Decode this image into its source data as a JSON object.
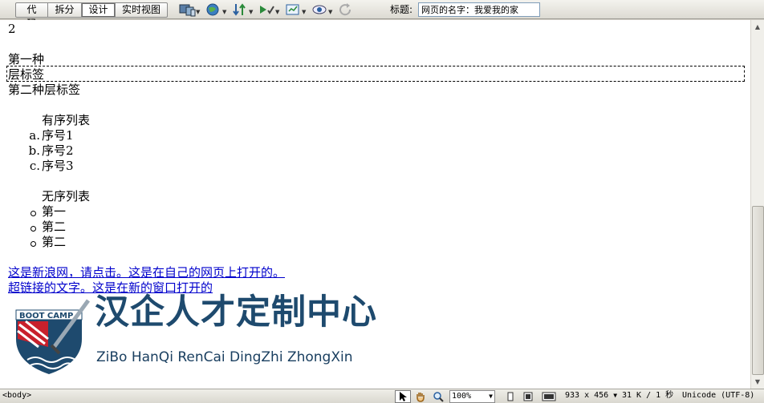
{
  "toolbar": {
    "views": [
      {
        "label": "代码",
        "active": false
      },
      {
        "label": "拆分",
        "active": false
      },
      {
        "label": "设计",
        "active": true
      },
      {
        "label": "实时视图",
        "active": false
      }
    ],
    "icons": [
      "multiscreen-icon",
      "preview-browser-icon",
      "file-management-icon",
      "check-page-icon",
      "visual-aids-icon",
      "view-options-icon",
      "refresh-icon"
    ],
    "title_label": "标题:",
    "title_value": "网页的名字：我爱我的家"
  },
  "canvas": {
    "lines_top": [
      "2",
      "",
      "第一种",
      "层标签",
      "第二种层标签",
      ""
    ],
    "ordered_caption": "有序列表",
    "ordered_items": [
      {
        "marker": "a.",
        "text": "序号1"
      },
      {
        "marker": "b.",
        "text": "序号2"
      },
      {
        "marker": "c.",
        "text": "序号3"
      }
    ],
    "unordered_caption": "无序列表",
    "unordered_items": [
      "第一",
      "第二",
      "第二"
    ],
    "links": [
      "这是新浪网，请点击。这是在自己的网页上打开的。",
      "超链接的文字。这是在新的窗口打开的"
    ],
    "logo": {
      "badge_text": "BOOT CAMP",
      "badge_small": "HAN QI",
      "title_cn": "汉企人才定制中心",
      "title_en": "ZiBo HanQi RenCai DingZhi ZhongXin"
    }
  },
  "statusbar": {
    "tag": "<body>",
    "zoom": "100%",
    "size": "933 x 456",
    "filesize": "31 K / 1 秒",
    "encoding": "Unicode (UTF-8)"
  },
  "colors": {
    "link": "#0000cc",
    "logo_navy": "#1e4a6e",
    "badge_red": "#c8202c"
  }
}
